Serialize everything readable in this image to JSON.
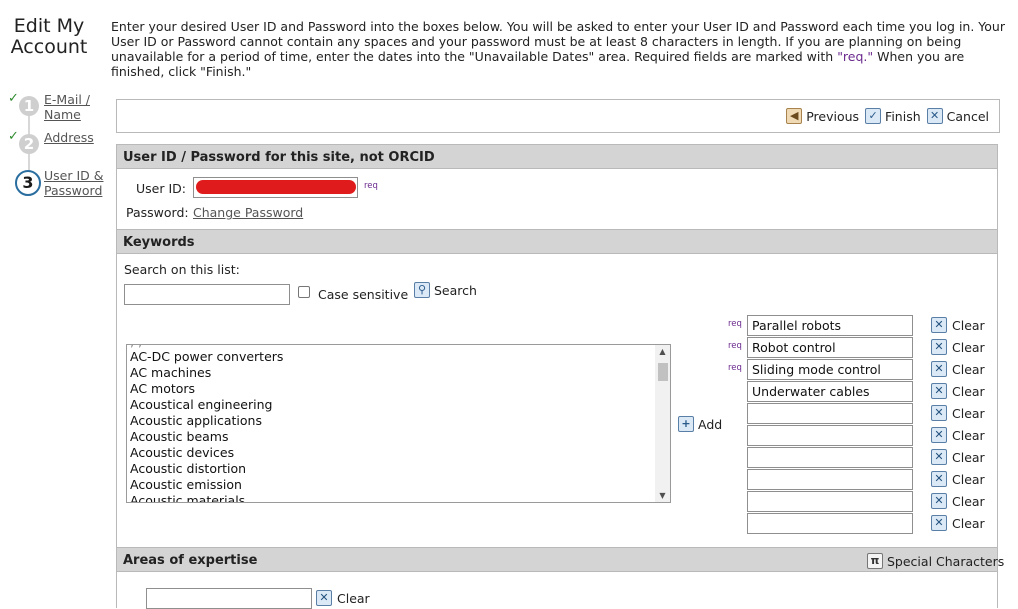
{
  "title": "Edit My Account",
  "steps": [
    {
      "number": "1",
      "label": "E-Mail / Name",
      "done": true
    },
    {
      "number": "2",
      "label": "Address",
      "done": true
    },
    {
      "number": "3",
      "label": "User ID & Password",
      "done": false
    }
  ],
  "intro": {
    "text": "Enter your desired User ID and Password into the boxes below. You will be asked to enter your User ID and Password each time you log in. Your User ID or Password cannot contain any spaces and your password must be at least 8 characters in length. If you are planning on being unavailable for a period of time, enter the dates into the \"Unavailable Dates\" area. Required fields are marked with ",
    "req": "\"req.\"",
    "text_end": " When you are finished, click \"Finish.\""
  },
  "toolbar": {
    "previous": "Previous",
    "finish": "Finish",
    "cancel": "Cancel"
  },
  "account_section": {
    "header": "User ID / Password for this site, not ORCID",
    "userid_label": "User ID:",
    "req_tag": "req",
    "password_label": "Password:",
    "change_password": "Change Password"
  },
  "keywords": {
    "header": "Keywords",
    "search_label": "Search on this list:",
    "search_value": "",
    "case_sensitive": "Case sensitive",
    "search_button": "Search",
    "add_button": "Add",
    "list_items": [
      "AC-DC power converters",
      "AC machines",
      "AC motors",
      "Acoustical engineering",
      "Acoustic applications",
      "Acoustic beams",
      "Acoustic devices",
      "Acoustic distortion",
      "Acoustic emission",
      "Acoustic materials"
    ],
    "selected": [
      "Parallel robots",
      "Robot control",
      "Sliding mode control",
      "Underwater cables",
      "",
      "",
      "",
      "",
      "",
      ""
    ],
    "required_count": 3,
    "req_tag": "req",
    "clear_label": "Clear"
  },
  "expertise": {
    "header": "Areas of expertise",
    "special_chars": "Special Characters",
    "input_value": "",
    "clear_label": "Clear"
  },
  "colors": {
    "section_header": "#d4d4d4",
    "req": "#6b2a8e",
    "check": "#2e8b2e"
  }
}
